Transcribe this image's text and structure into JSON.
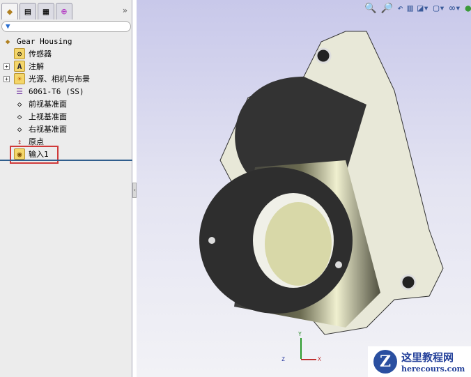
{
  "tree": {
    "root": "Gear Housing",
    "items": [
      {
        "label": "传感器",
        "icon": "sensor-folder-icon"
      },
      {
        "label": "注解",
        "icon": "annotation-folder-icon",
        "expandable": true
      },
      {
        "label": "光源、相机与布景",
        "icon": "lights-folder-icon",
        "expandable": true
      },
      {
        "label": "6061-T6 (SS)",
        "icon": "material-icon"
      },
      {
        "label": "前视基准面",
        "icon": "plane-icon"
      },
      {
        "label": "上视基准面",
        "icon": "plane-icon"
      },
      {
        "label": "右视基准面",
        "icon": "plane-icon"
      },
      {
        "label": "原点",
        "icon": "origin-icon"
      },
      {
        "label": "输入1",
        "icon": "imported-body-icon",
        "highlighted": true
      }
    ]
  },
  "watermark": {
    "title": "这里教程网",
    "url": "herecours.com"
  },
  "axes": {
    "x": "X",
    "y": "Y",
    "z": "Z"
  }
}
